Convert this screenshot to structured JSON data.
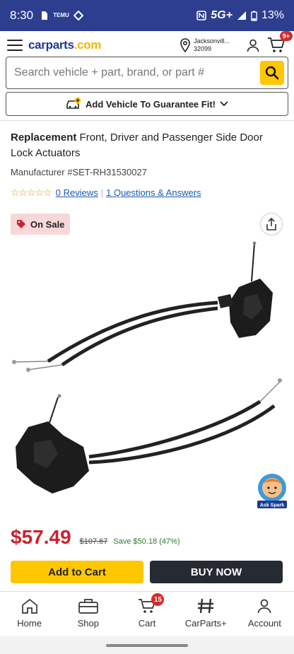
{
  "status_bar": {
    "time": "8:30",
    "tag_label": "TEMU",
    "network": "5G+",
    "battery": "13%"
  },
  "header": {
    "logo_main": "carparts",
    "logo_tld": ".com",
    "location_city": "Jacksonvill...",
    "location_zip": "32099",
    "cart_badge": "9+"
  },
  "search": {
    "placeholder": "Search vehicle + part, brand, or part #"
  },
  "fit_banner": {
    "label": "Add Vehicle To Guarantee Fit!"
  },
  "product": {
    "title_bold": "Replacement",
    "title_rest": " Front, Driver and Passenger Side Door Lock Actuators",
    "manufacturer_label": "Manufacturer #",
    "manufacturer_number": "SET-RH31530027",
    "stars": "☆☆☆☆☆",
    "reviews_link": "0 Reviews",
    "qa_link": "1 Questions & Answers",
    "sale_label": "On Sale",
    "image_alt": "door lock actuator"
  },
  "pricing": {
    "price": "$57.49",
    "old_price": "$107.67",
    "save_text": "Save $50.18 (47%)"
  },
  "actions": {
    "add_to_cart": "Add to Cart",
    "buy_now": "BUY NOW"
  },
  "assistant": {
    "label": "Ask Spark"
  },
  "bottom_nav": {
    "home": "Home",
    "shop": "Shop",
    "cart": "Cart",
    "cart_count": "15",
    "carparts_plus": "CarParts+",
    "account": "Account"
  },
  "colors": {
    "status_bar": "#2d3e8f",
    "brand_blue": "#1a3a94",
    "accent_yellow": "#ffc700",
    "price_red": "#c8232c",
    "save_green": "#2d7a2d",
    "buy_dark": "#262a33"
  }
}
